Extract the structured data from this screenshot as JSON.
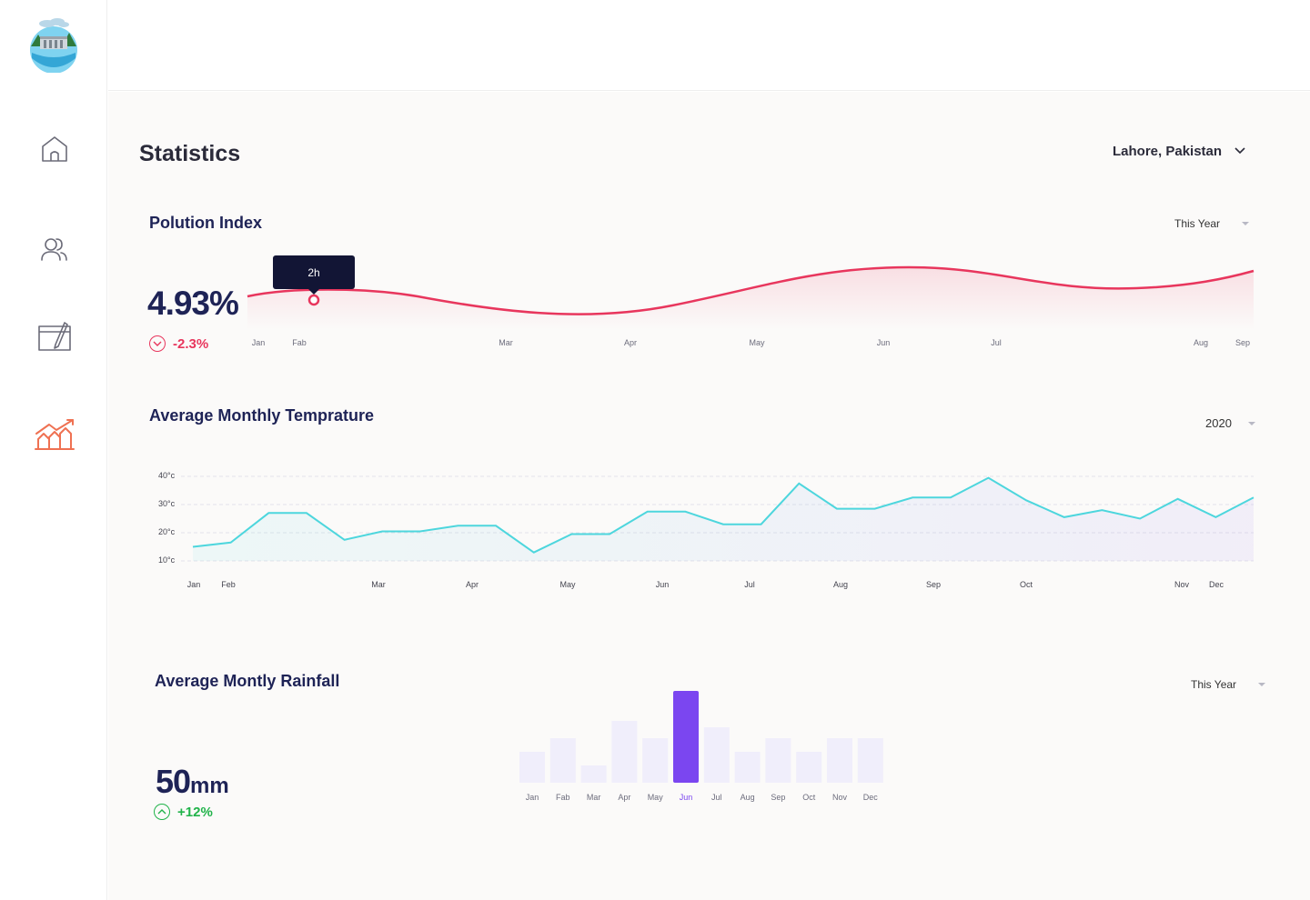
{
  "nav": {
    "logo_icon": "dam-landscape-logo",
    "items": [
      {
        "icon": "home-icon",
        "active": false
      },
      {
        "icon": "users-icon",
        "active": false
      },
      {
        "icon": "edit-calendar-icon",
        "active": false
      },
      {
        "icon": "statistics-icon",
        "active": true
      }
    ]
  },
  "page": {
    "title": "Statistics",
    "location": "Lahore, Pakistan"
  },
  "pollution": {
    "title": "Polution Index",
    "period": "This Year",
    "value": "4.93%",
    "delta": "-2.3%",
    "tooltip": "2h",
    "color": "#e8365d",
    "months": [
      "Jan",
      "Fab",
      "Mar",
      "Apr",
      "May",
      "Jun",
      "Jul",
      "Aug",
      "Sep"
    ]
  },
  "temperature": {
    "title": "Average Monthly Temprature",
    "period": "2020",
    "color": "#4dd6dd",
    "y_ticks": [
      "40°c",
      "30°c",
      "20°c",
      "10°c"
    ],
    "months": [
      "Jan",
      "Feb",
      "Mar",
      "Apr",
      "May",
      "Jun",
      "Jul",
      "Aug",
      "Sep",
      "Oct",
      "Nov",
      "Dec"
    ]
  },
  "rainfall": {
    "title": "Average Montly Rainfall",
    "period": "This Year",
    "value": "50",
    "unit": "mm",
    "delta": "+12%",
    "color": "#7b46f0"
  },
  "chart_data": [
    {
      "type": "area",
      "title": "Polution Index",
      "categories": [
        "Jan",
        "Fab",
        "Mar",
        "Apr",
        "May",
        "Jun",
        "Jul",
        "Aug",
        "Sep"
      ],
      "series": [
        {
          "values": [
            0.72,
            0.82,
            0.2,
            0.18,
            0.5,
            1.0,
            0.93,
            0.68,
            0.95
          ]
        }
      ],
      "highlight": {
        "category": "Fab",
        "label": "2h"
      },
      "grid": false
    },
    {
      "type": "line",
      "title": "Average Monthly Temprature",
      "ylim": [
        10,
        40
      ],
      "yticks": [
        "40°c",
        "30°c",
        "20°c",
        "10°c"
      ],
      "x_labels": [
        "Jan",
        "Feb",
        "Mar",
        "Apr",
        "May",
        "Jun",
        "Jul",
        "Aug",
        "Sep",
        "Oct",
        "Nov",
        "Dec"
      ],
      "series": [
        {
          "values": [
            15,
            16.5,
            27,
            27,
            17.5,
            20.5,
            20.5,
            22.5,
            22.5,
            13,
            19.5,
            19.5,
            27.5,
            27.5,
            23,
            23,
            37.5,
            28.5,
            28.5,
            32.5,
            32.5,
            39.5,
            31.5,
            25.5,
            28,
            25,
            32,
            25.5,
            32.5
          ]
        }
      ],
      "grid": true
    },
    {
      "type": "bar",
      "title": "Average Montly Rainfall",
      "categories": [
        "Jan",
        "Fab",
        "Mar",
        "Apr",
        "May",
        "Jun",
        "Jul",
        "Aug",
        "Sep",
        "Oct",
        "Nov",
        "Dec"
      ],
      "values": [
        34,
        49,
        19,
        68,
        49,
        101,
        61,
        34,
        49,
        34,
        49,
        49
      ],
      "highlight": "Jun"
    }
  ]
}
